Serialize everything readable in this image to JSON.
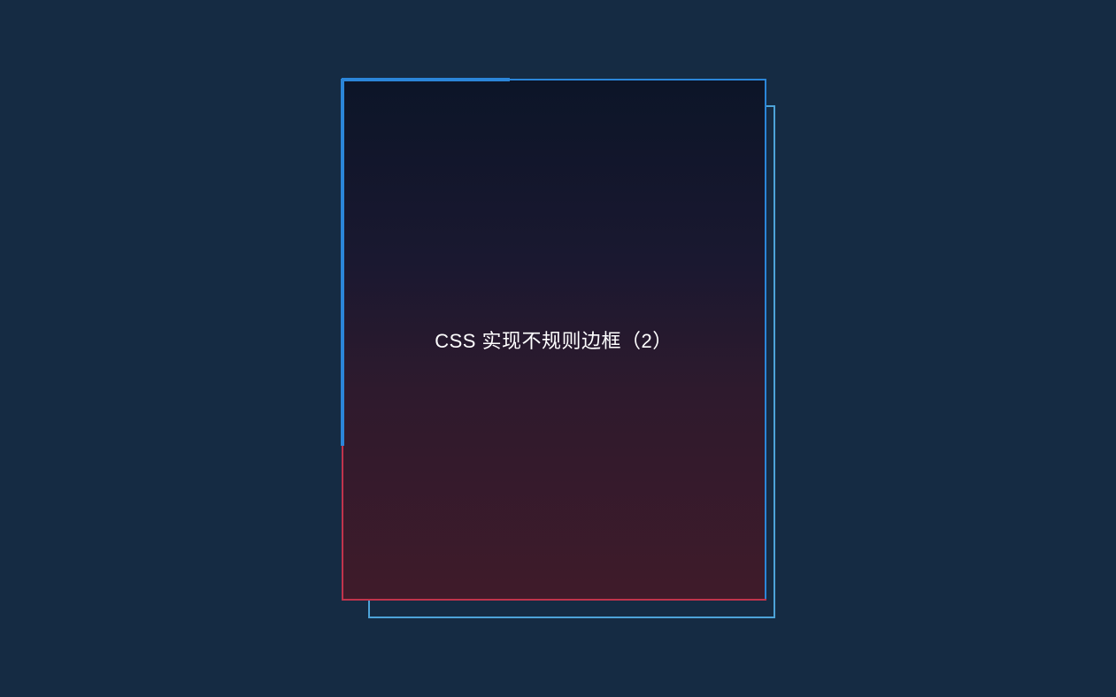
{
  "card": {
    "title": "CSS 实现不规则边框（2）"
  },
  "colors": {
    "background": "#152b43",
    "border_blue": "#2b86d9",
    "border_cyan": "#4da3d8",
    "border_red": "#c0344c",
    "gradient_top": "#0c1528",
    "gradient_bottom": "#3f1b2a",
    "text": "#ffffff"
  }
}
